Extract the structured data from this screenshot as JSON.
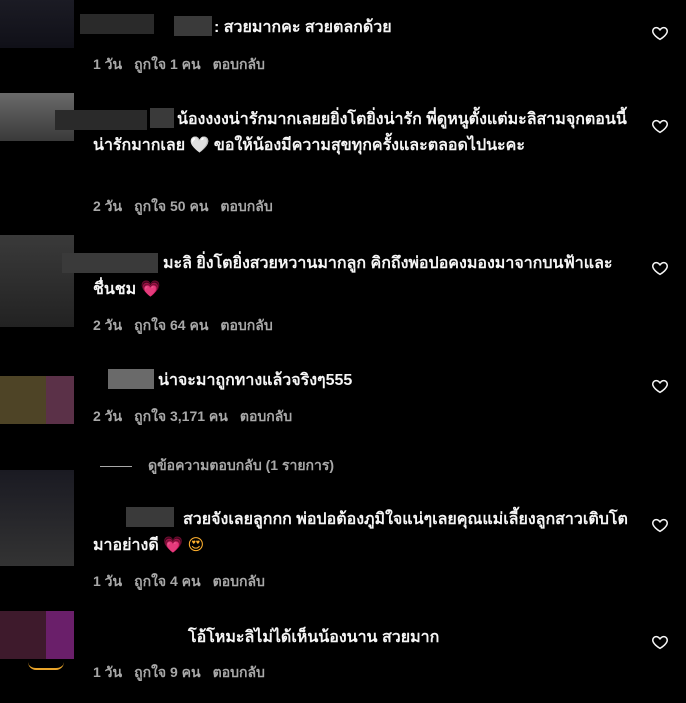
{
  "comments": [
    {
      "text": ": สวยมากคะ สวยตลกด้วย",
      "time": "1 วัน",
      "likes": "ถูกใจ 1 คน",
      "reply": "ตอบกลับ"
    },
    {
      "text": "น้องงงงน่ารักมากเลยยยิ่งโตยิ่งน่ารัก พี่ดูหนูตั้งแต่มะลิสามจุกตอนนี้น่ารักมากเลย",
      "emoji": "🤍",
      "text2": "ขอให้น้องมีความสุขทุกครั้งและตลอดไปนะคะ",
      "time": "2 วัน",
      "likes": "ถูกใจ 50 คน",
      "reply": "ตอบกลับ"
    },
    {
      "text": "มะลิ ยิ่งโตยิ่งสวยหวานมากลูก คิกถึงพ่อปอคงมองมาจากบนฟ้าและชื่นชม",
      "emoji": "💗",
      "time": "2 วัน",
      "likes": "ถูกใจ 64 คน",
      "reply": "ตอบกลับ"
    },
    {
      "text": "น่าจะมาถูกทางแล้วจริงๆ555",
      "time": "2 วัน",
      "likes": "ถูกใจ 3,171 คน",
      "reply": "ตอบกลับ"
    },
    {
      "text": "สวยจังเลยลูกกก พ่อปอต้องภูมิใจแน่ๆเลยคุณแม่เลี้ยงลูกสาวเติบโตมาอย่างดี",
      "emoji": "💗",
      "emoji2": "😍",
      "time": "1 วัน",
      "likes": "ถูกใจ 4 คน",
      "reply": "ตอบกลับ"
    },
    {
      "text": "โอ้โหมะลิไม่ได้เห็นน้องนาน สวยมาก",
      "time": "1 วัน",
      "likes": "ถูกใจ 9 คน",
      "reply": "ตอบกลับ"
    }
  ],
  "view_replies": "ดูข้อความตอบกลับ (1 รายการ)",
  "icons": {
    "like": "heart-outline-icon"
  },
  "colors": {
    "bg": "#000000",
    "text": "#f5f5f5",
    "meta": "#a8a8a8"
  }
}
